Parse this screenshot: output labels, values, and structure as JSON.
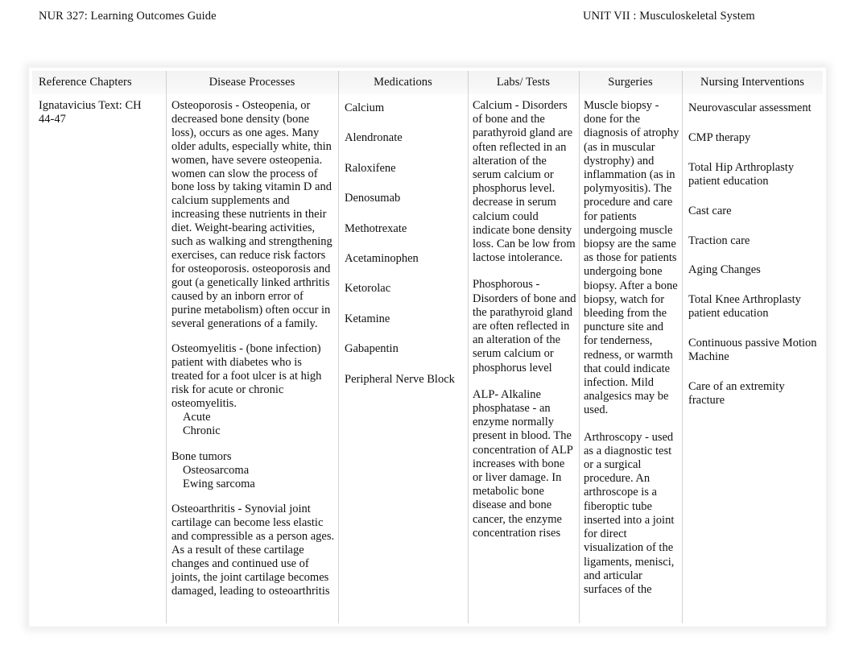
{
  "header": {
    "left": "NUR 327: Learning Outcomes Guide",
    "right": "UNIT VII : Musculoskeletal System"
  },
  "table": {
    "columns": [
      {
        "header": "Reference Chapters"
      },
      {
        "header": "Disease Processes"
      },
      {
        "header": "Medications"
      },
      {
        "header": "Labs/ Tests"
      },
      {
        "header": "Surgeries"
      },
      {
        "header": "Nursing Interventions"
      }
    ],
    "reference_chapters": {
      "text": "Ignatavicius   Text: CH 44-47"
    },
    "disease_processes": {
      "osteoporosis": "Osteoporosis - Osteopenia, or decreased bone density (bone loss), occurs as one ages. Many older adults, especially white, thin women, have severe osteopenia. women can slow the process of bone loss by taking vitamin D and calcium supplements and increasing these nutrients in their diet. Weight-bearing activities, such as walking and strengthening exercises, can reduce risk factors for osteoporosis. osteoporosis and gout (a genetically linked arthritis caused by an inborn error of purine metabolism) often occur in several generations of a family.",
      "osteomyelitis": "Osteomyelitis - (bone infection) patient with diabetes who is treated for a foot ulcer is at high risk for acute or chronic osteomyelitis.",
      "osteomyelitis_sub_1": "Acute",
      "osteomyelitis_sub_2": "Chronic",
      "bone_tumors": "Bone tumors",
      "bone_tumors_sub_1": "Osteosarcoma",
      "bone_tumors_sub_2": "Ewing sarcoma",
      "osteoarthritis": "Osteoarthritis  - Synovial joint cartilage can become less elastic and compressible as a person ages. As a result of these cartilage changes and continued use of joints, the joint cartilage becomes damaged, leading to osteoarthritis"
    },
    "medications": [
      "Calcium",
      "Alendronate",
      "Raloxifene",
      "Denosumab",
      "Methotrexate",
      "Acetaminophen",
      "Ketorolac",
      "Ketamine",
      "Gabapentin",
      "Peripheral Nerve Block"
    ],
    "labs_tests": {
      "calcium": "Calcium - Disorders of bone and the parathyroid gland are often reflected in an alteration of the serum calcium or phosphorus level. decrease in serum calcium could indicate bone density loss. Can be low from lactose intolerance.",
      "phosphorous": "Phosphorous  - Disorders of bone and the parathyroid gland are often reflected in an alteration of the serum calcium or phosphorus level",
      "alp": "ALP- Alkaline phosphatase  - an enzyme normally present in blood. The concentration of ALP increases with bone or liver damage. In metabolic bone disease and bone cancer, the enzyme concentration rises"
    },
    "surgeries": {
      "muscle_biopsy": "Muscle biopsy - done for the diagnosis of atrophy (as in muscular dystrophy) and inflammation (as in polymyositis). The procedure and care for patients undergoing muscle biopsy are the same as those for patients undergoing bone biopsy. After a bone biopsy, watch for bleeding from the puncture site and for tenderness, redness, or warmth that could indicate infection. Mild analgesics may be used.",
      "arthroscopy": "Arthroscopy  - used as a diagnostic test or a surgical procedure. An arthroscope is a fiberoptic tube inserted into a joint for direct visualization of the ligaments, menisci, and articular surfaces of the"
    },
    "nursing_interventions": [
      "Neurovascular assessment",
      "CMP therapy",
      "Total Hip Arthroplasty patient education",
      "Cast care",
      "Traction care",
      "Aging Changes",
      "Total Knee Arthroplasty patient education",
      "Continuous passive Motion Machine",
      "Care of an extremity fracture"
    ]
  }
}
